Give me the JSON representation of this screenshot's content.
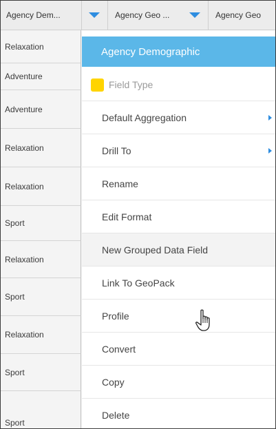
{
  "header": {
    "columns": [
      {
        "label": "Agency Dem..."
      },
      {
        "label": "Agency Geo ..."
      },
      {
        "label": "Agency Geo"
      }
    ]
  },
  "rows": [
    "Relaxation",
    "Adventure",
    "Adventure",
    "Relaxation",
    "Relaxation",
    "Sport",
    "Relaxation",
    "Sport",
    "Relaxation",
    "Sport",
    "Sport"
  ],
  "menu": {
    "title": "Agency Demographic",
    "field_type_label": "Field Type",
    "field_type_color": "#ffd400",
    "items": {
      "default_aggregation": "Default Aggregation",
      "drill_to": "Drill To",
      "rename": "Rename",
      "edit_format": "Edit Format",
      "new_grouped": "New Grouped Data Field",
      "link_geopack": "Link To GeoPack",
      "profile": "Profile",
      "convert": "Convert",
      "copy": "Copy",
      "delete": "Delete"
    }
  },
  "colors": {
    "menu_title_bg": "#5bb7e8",
    "accent": "#2e8de0"
  }
}
